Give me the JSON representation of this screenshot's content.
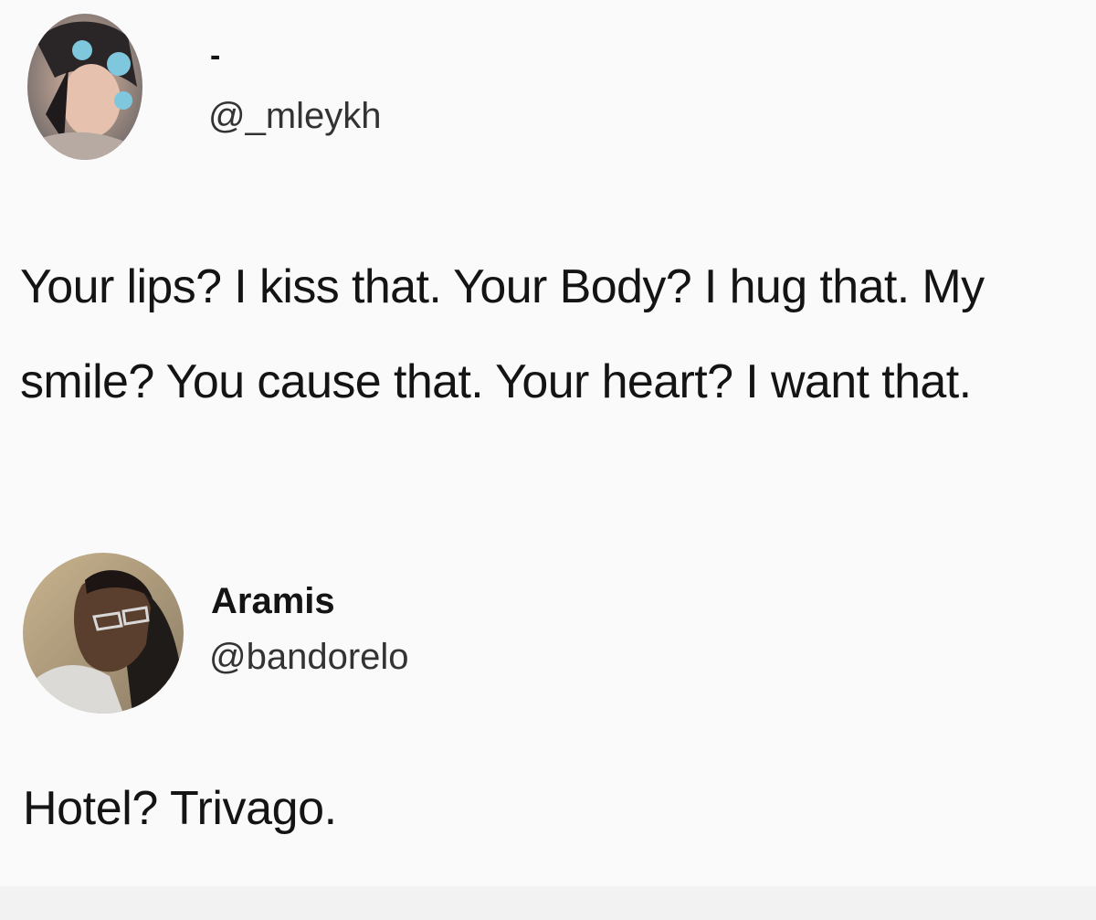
{
  "tweets": [
    {
      "display_name": "-",
      "handle": "@_mleykh",
      "text": "Your lips? I kiss that. Your Body? I hug that. My smile? You cause that. Your heart? I want that."
    },
    {
      "display_name": "Aramis",
      "handle": "@bandorelo",
      "text": "Hotel? Trivago."
    }
  ]
}
